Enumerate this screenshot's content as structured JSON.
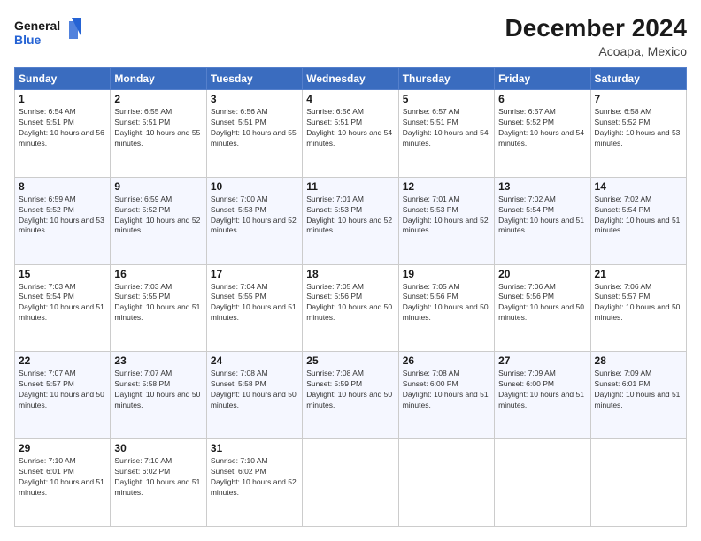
{
  "logo": {
    "line1": "General",
    "line2": "Blue"
  },
  "title": "December 2024",
  "location": "Acoapa, Mexico",
  "days_of_week": [
    "Sunday",
    "Monday",
    "Tuesday",
    "Wednesday",
    "Thursday",
    "Friday",
    "Saturday"
  ],
  "weeks": [
    [
      {
        "day": "1",
        "sunrise": "6:54 AM",
        "sunset": "5:51 PM",
        "daylight": "10 hours and 56 minutes."
      },
      {
        "day": "2",
        "sunrise": "6:55 AM",
        "sunset": "5:51 PM",
        "daylight": "10 hours and 55 minutes."
      },
      {
        "day": "3",
        "sunrise": "6:56 AM",
        "sunset": "5:51 PM",
        "daylight": "10 hours and 55 minutes."
      },
      {
        "day": "4",
        "sunrise": "6:56 AM",
        "sunset": "5:51 PM",
        "daylight": "10 hours and 54 minutes."
      },
      {
        "day": "5",
        "sunrise": "6:57 AM",
        "sunset": "5:51 PM",
        "daylight": "10 hours and 54 minutes."
      },
      {
        "day": "6",
        "sunrise": "6:57 AM",
        "sunset": "5:52 PM",
        "daylight": "10 hours and 54 minutes."
      },
      {
        "day": "7",
        "sunrise": "6:58 AM",
        "sunset": "5:52 PM",
        "daylight": "10 hours and 53 minutes."
      }
    ],
    [
      {
        "day": "8",
        "sunrise": "6:59 AM",
        "sunset": "5:52 PM",
        "daylight": "10 hours and 53 minutes."
      },
      {
        "day": "9",
        "sunrise": "6:59 AM",
        "sunset": "5:52 PM",
        "daylight": "10 hours and 52 minutes."
      },
      {
        "day": "10",
        "sunrise": "7:00 AM",
        "sunset": "5:53 PM",
        "daylight": "10 hours and 52 minutes."
      },
      {
        "day": "11",
        "sunrise": "7:01 AM",
        "sunset": "5:53 PM",
        "daylight": "10 hours and 52 minutes."
      },
      {
        "day": "12",
        "sunrise": "7:01 AM",
        "sunset": "5:53 PM",
        "daylight": "10 hours and 52 minutes."
      },
      {
        "day": "13",
        "sunrise": "7:02 AM",
        "sunset": "5:54 PM",
        "daylight": "10 hours and 51 minutes."
      },
      {
        "day": "14",
        "sunrise": "7:02 AM",
        "sunset": "5:54 PM",
        "daylight": "10 hours and 51 minutes."
      }
    ],
    [
      {
        "day": "15",
        "sunrise": "7:03 AM",
        "sunset": "5:54 PM",
        "daylight": "10 hours and 51 minutes."
      },
      {
        "day": "16",
        "sunrise": "7:03 AM",
        "sunset": "5:55 PM",
        "daylight": "10 hours and 51 minutes."
      },
      {
        "day": "17",
        "sunrise": "7:04 AM",
        "sunset": "5:55 PM",
        "daylight": "10 hours and 51 minutes."
      },
      {
        "day": "18",
        "sunrise": "7:05 AM",
        "sunset": "5:56 PM",
        "daylight": "10 hours and 50 minutes."
      },
      {
        "day": "19",
        "sunrise": "7:05 AM",
        "sunset": "5:56 PM",
        "daylight": "10 hours and 50 minutes."
      },
      {
        "day": "20",
        "sunrise": "7:06 AM",
        "sunset": "5:56 PM",
        "daylight": "10 hours and 50 minutes."
      },
      {
        "day": "21",
        "sunrise": "7:06 AM",
        "sunset": "5:57 PM",
        "daylight": "10 hours and 50 minutes."
      }
    ],
    [
      {
        "day": "22",
        "sunrise": "7:07 AM",
        "sunset": "5:57 PM",
        "daylight": "10 hours and 50 minutes."
      },
      {
        "day": "23",
        "sunrise": "7:07 AM",
        "sunset": "5:58 PM",
        "daylight": "10 hours and 50 minutes."
      },
      {
        "day": "24",
        "sunrise": "7:08 AM",
        "sunset": "5:58 PM",
        "daylight": "10 hours and 50 minutes."
      },
      {
        "day": "25",
        "sunrise": "7:08 AM",
        "sunset": "5:59 PM",
        "daylight": "10 hours and 50 minutes."
      },
      {
        "day": "26",
        "sunrise": "7:08 AM",
        "sunset": "6:00 PM",
        "daylight": "10 hours and 51 minutes."
      },
      {
        "day": "27",
        "sunrise": "7:09 AM",
        "sunset": "6:00 PM",
        "daylight": "10 hours and 51 minutes."
      },
      {
        "day": "28",
        "sunrise": "7:09 AM",
        "sunset": "6:01 PM",
        "daylight": "10 hours and 51 minutes."
      }
    ],
    [
      {
        "day": "29",
        "sunrise": "7:10 AM",
        "sunset": "6:01 PM",
        "daylight": "10 hours and 51 minutes."
      },
      {
        "day": "30",
        "sunrise": "7:10 AM",
        "sunset": "6:02 PM",
        "daylight": "10 hours and 51 minutes."
      },
      {
        "day": "31",
        "sunrise": "7:10 AM",
        "sunset": "6:02 PM",
        "daylight": "10 hours and 52 minutes."
      },
      null,
      null,
      null,
      null
    ]
  ]
}
